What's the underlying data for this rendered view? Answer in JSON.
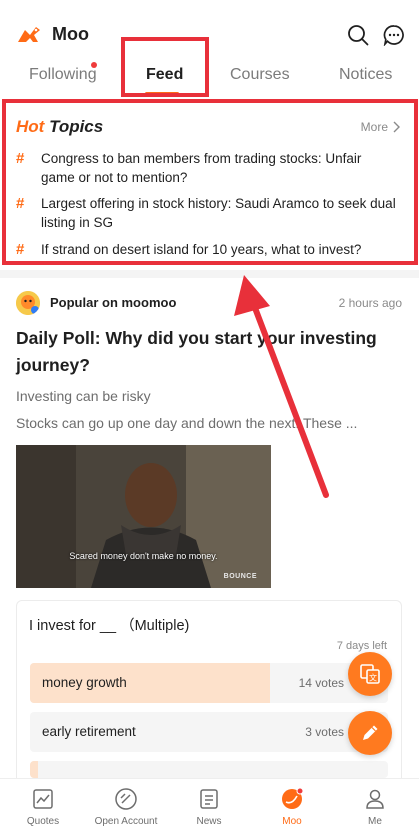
{
  "app": {
    "title": "Moo"
  },
  "tabs": [
    {
      "label": "Following"
    },
    {
      "label": "Feed"
    },
    {
      "label": "Courses"
    },
    {
      "label": "Notices"
    }
  ],
  "hot_topics": {
    "title_hot": "Hot",
    "title_topics": "Topics",
    "more": "More",
    "items": [
      {
        "hash": "#",
        "text": "Congress to ban members from trading stocks: Unfair game or not to mention?"
      },
      {
        "hash": "#",
        "text": "Largest offering in stock history: Saudi Aramco to seek dual listing in SG"
      },
      {
        "hash": "#",
        "text": "If strand on desert island for 10 years, what to invest?"
      }
    ]
  },
  "post": {
    "author": "Popular on moomoo",
    "time": "2 hours ago",
    "title": "Daily Poll: Why did you start your investing journey?",
    "subtitle": "Investing can be risky",
    "body": "Stocks can go up one day and down the next. These ...",
    "image_caption": "Scared money don't make no money.",
    "image_brand": "BOUNCE"
  },
  "poll": {
    "question": "I invest for __ （Multiple)",
    "time_left": "7 days left",
    "options": [
      {
        "label": "money growth",
        "votes": "14 votes",
        "share": 0.67
      },
      {
        "label": "early retirement",
        "votes": "3 votes",
        "share": 0.0
      }
    ]
  },
  "bottom_nav": [
    {
      "label": "Quotes"
    },
    {
      "label": "Open Account"
    },
    {
      "label": "News"
    },
    {
      "label": "Moo"
    },
    {
      "label": "Me"
    }
  ],
  "colors": {
    "accent": "#ff6b16",
    "annotation": "#e8303a",
    "poll_fill": "#fde1cb"
  }
}
